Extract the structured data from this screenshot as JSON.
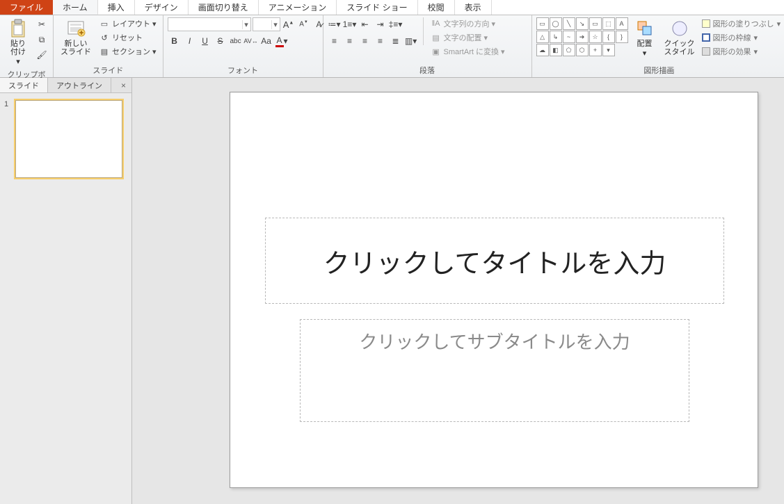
{
  "tabs": {
    "file": "ファイル",
    "home": "ホーム",
    "insert": "挿入",
    "design": "デザイン",
    "transitions": "画面切り替え",
    "animations": "アニメーション",
    "slideshow": "スライド ショー",
    "review": "校閲",
    "view": "表示"
  },
  "ribbon": {
    "clipboard": {
      "label": "クリップボード",
      "paste": "貼り付け"
    },
    "slides": {
      "label": "スライド",
      "new": "新しい\nスライド",
      "layout": "レイアウト",
      "reset": "リセット",
      "section": "セクション"
    },
    "font": {
      "label": "フォント",
      "name": "",
      "size": "",
      "bold": "B",
      "italic": "I",
      "underline": "U",
      "strike": "S",
      "shadow": "abc",
      "spacing": "AV",
      "case": "Aa",
      "grow": "A",
      "shrink": "A",
      "clear": "A",
      "color": "A"
    },
    "paragraph": {
      "label": "段落",
      "text_dir": "文字列の方向",
      "text_align": "文字の配置",
      "smartart": "SmartArt に変換"
    },
    "drawing": {
      "label": "図形描画",
      "arrange": "配置",
      "quick": "クイック\nスタイル",
      "fill": "図形の塗りつぶし",
      "outline": "図形の枠線",
      "effects": "図形の効果"
    }
  },
  "side_panel": {
    "tab_slides": "スライド",
    "tab_outline": "アウトライン",
    "slide_number": "1"
  },
  "slide": {
    "title_placeholder": "クリックしてタイトルを入力",
    "subtitle_placeholder": "クリックしてサブタイトルを入力"
  },
  "colors": {
    "file_tab": "#cf4315"
  }
}
